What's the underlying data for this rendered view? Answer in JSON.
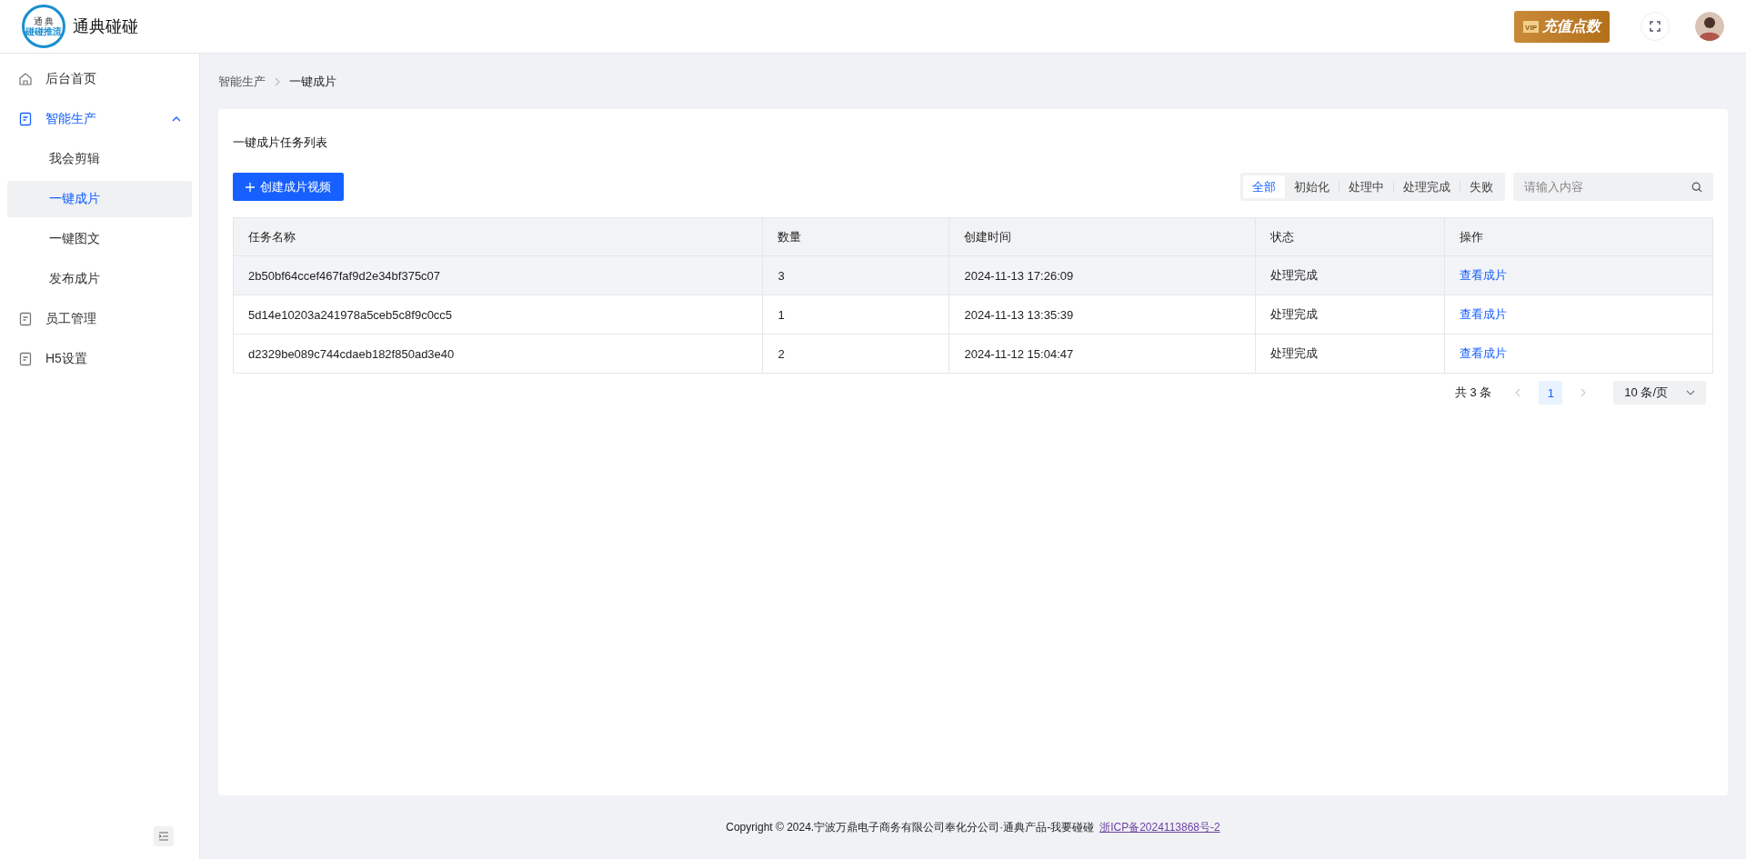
{
  "header": {
    "logo": {
      "top": "通 典",
      "bottom": "碰碰推流"
    },
    "brand": "通典碰碰",
    "vip": {
      "badge": "VIP",
      "label": "充值点数"
    }
  },
  "sidebar": {
    "items": [
      {
        "label": "后台首页",
        "kind": "home",
        "selected": false
      },
      {
        "label": "智能生产",
        "kind": "doc",
        "selected": true,
        "expanded": true,
        "children": [
          {
            "label": "我会剪辑",
            "selected": false
          },
          {
            "label": "一键成片",
            "selected": true
          },
          {
            "label": "一键图文",
            "selected": false
          },
          {
            "label": "发布成片",
            "selected": false
          }
        ]
      },
      {
        "label": "员工管理",
        "kind": "doc",
        "selected": false
      },
      {
        "label": "H5设置",
        "kind": "doc",
        "selected": false
      }
    ]
  },
  "breadcrumb": [
    "智能生产",
    "一键成片"
  ],
  "card": {
    "title": "一键成片任务列表",
    "create_button": "创建成片视频",
    "filters": [
      {
        "label": "全部",
        "selected": true
      },
      {
        "label": "初始化",
        "selected": false
      },
      {
        "label": "处理中",
        "selected": false
      },
      {
        "label": "处理完成",
        "selected": false
      },
      {
        "label": "失败",
        "selected": false
      }
    ],
    "search": {
      "placeholder": "请输入内容"
    }
  },
  "table": {
    "columns": [
      "任务名称",
      "数量",
      "创建时间",
      "状态",
      "操作"
    ],
    "rows": [
      {
        "cells": [
          "2b50bf64ccef467faf9d2e34bf375c07",
          "3",
          "2024-11-13 17:26:09",
          "处理完成"
        ],
        "action": "查看成片",
        "hovered": true
      },
      {
        "cells": [
          "5d14e10203a241978a5ceb5c8f9c0cc5",
          "1",
          "2024-11-13 13:35:39",
          "处理完成"
        ],
        "action": "查看成片",
        "hovered": false
      },
      {
        "cells": [
          "d2329be089c744cdaeb182f850ad3e40",
          "2",
          "2024-11-12 15:04:47",
          "处理完成"
        ],
        "action": "查看成片",
        "hovered": false
      }
    ]
  },
  "pagination": {
    "total": "共 3 条",
    "pages": [
      {
        "label": "1",
        "selected": true
      }
    ],
    "page_size": "10 条/页"
  },
  "footer": {
    "text": "Copyright © 2024.宁波万鼎电子商务有限公司奉化分公司·通典产品-我要碰碰",
    "link": "浙ICP备2024113868号-2"
  }
}
